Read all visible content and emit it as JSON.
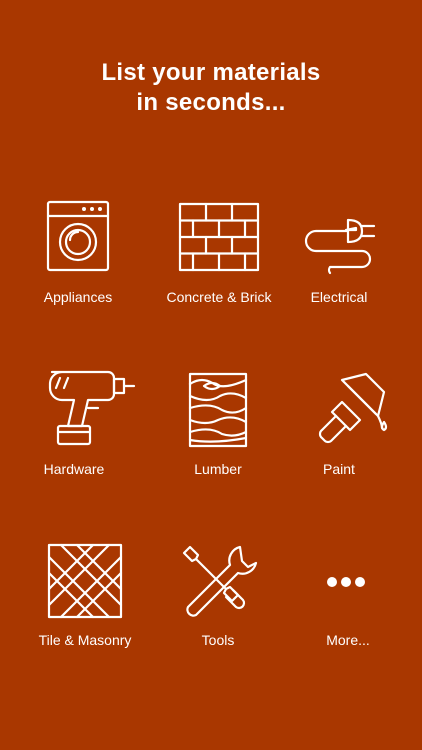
{
  "headline": {
    "line1": "List your materials",
    "line2": "in seconds..."
  },
  "categories": [
    {
      "label": "Appliances",
      "icon": "washing-machine-icon"
    },
    {
      "label": "Concrete & Brick",
      "icon": "brick-wall-icon"
    },
    {
      "label": "Electrical",
      "icon": "electrical-plug-icon"
    },
    {
      "label": "Hardware",
      "icon": "power-drill-icon"
    },
    {
      "label": "Lumber",
      "icon": "wood-grain-icon"
    },
    {
      "label": "Paint",
      "icon": "paint-brush-icon"
    },
    {
      "label": "Tile & Masonry",
      "icon": "tile-pattern-icon"
    },
    {
      "label": "Tools",
      "icon": "wrench-screwdriver-icon"
    },
    {
      "label": "More...",
      "icon": "ellipsis-icon"
    }
  ],
  "colors": {
    "background": "#A93700",
    "foreground": "#FFFFFF"
  }
}
